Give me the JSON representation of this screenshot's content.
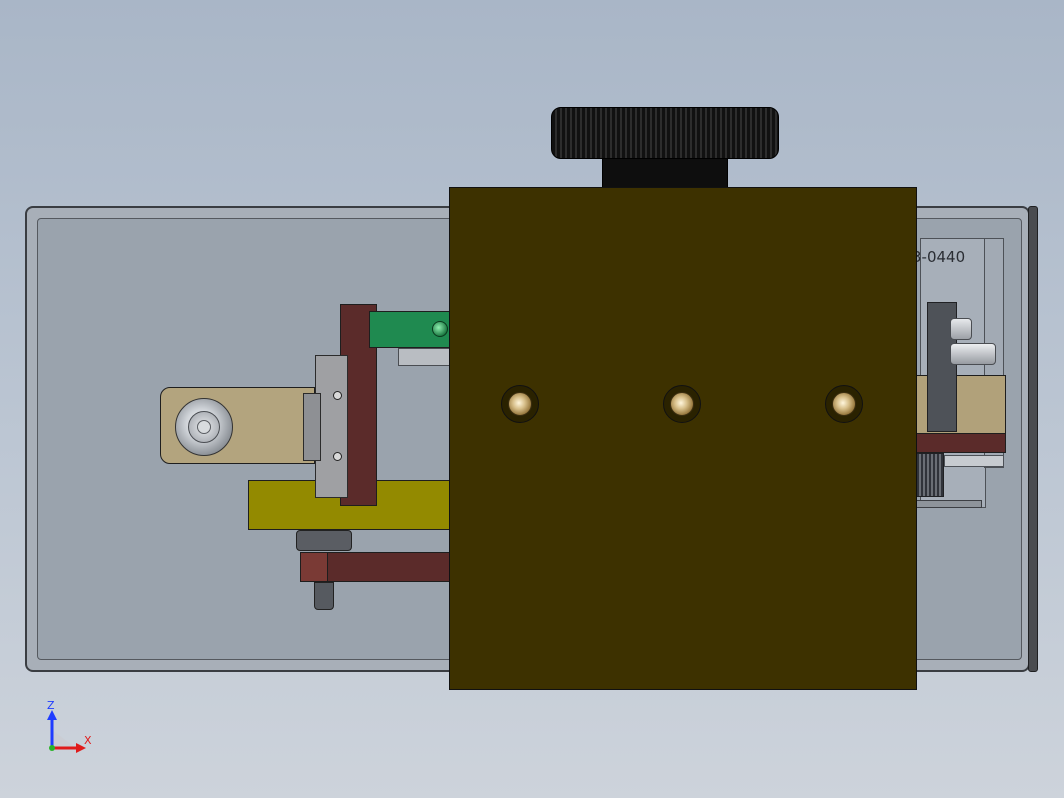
{
  "viewport": {
    "part_number_label": "3-0440"
  },
  "triad": {
    "z_label": "Z",
    "x_label": "X"
  },
  "colors": {
    "background_top": "#a9b6c7",
    "background_bottom": "#cdd3db",
    "cover": "#3d3100",
    "brown_parts": "#5b2b2a",
    "olive_plate": "#938a00",
    "green_block": "#1f8a50",
    "tan_parts": "#b3a47e",
    "knob": "#111111",
    "axis_z": "#1f3cff",
    "axis_x": "#e01b1b"
  },
  "icons": {
    "triad": "coordinate-triad-icon"
  }
}
